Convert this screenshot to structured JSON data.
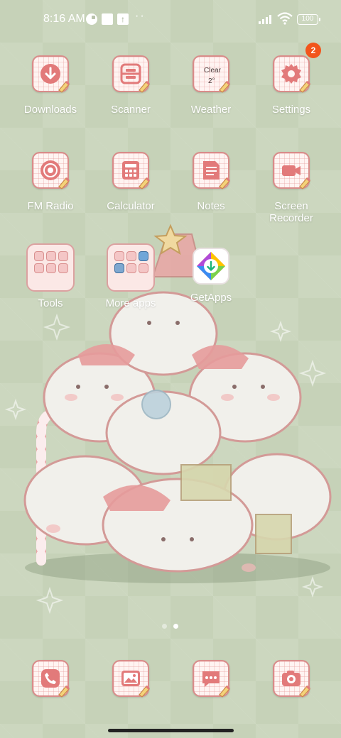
{
  "status_bar": {
    "time": "8:16 AM",
    "battery": "100",
    "icons": [
      "data-saver-icon",
      "notification-square-icon",
      "upload-icon",
      "more-dots-icon",
      "signal-icon",
      "wifi-icon",
      "battery-icon"
    ]
  },
  "apps": [
    {
      "label": "Downloads",
      "icon": "download-arrow-icon"
    },
    {
      "label": "Scanner",
      "icon": "scanner-icon"
    },
    {
      "label": "Weather",
      "icon": "weather-icon",
      "condition": "Clear",
      "temperature": "2°"
    },
    {
      "label": "Settings",
      "icon": "gear-icon",
      "badge": "2"
    },
    {
      "label": "FM Radio",
      "icon": "radio-icon"
    },
    {
      "label": "Calculator",
      "icon": "calculator-icon"
    },
    {
      "label": "Notes",
      "icon": "notes-icon"
    },
    {
      "label": "Screen\nRecorder",
      "icon": "video-camera-icon"
    },
    {
      "label": "Tools",
      "icon": "folder-icon"
    },
    {
      "label": "More apps",
      "icon": "folder-icon"
    },
    {
      "label": "GetApps",
      "icon": "getapps-icon"
    }
  ],
  "dock": [
    {
      "icon": "phone-icon"
    },
    {
      "icon": "gallery-icon"
    },
    {
      "icon": "messages-icon"
    },
    {
      "icon": "camera-icon"
    }
  ],
  "pages": {
    "count": 2,
    "active": 2
  },
  "colors": {
    "wallpaper": "#c6d2b8",
    "icon_outline": "#d98c8a",
    "icon_fill": "#fff4f2",
    "accent_pink": "#e27a7a",
    "badge": "#f2551c",
    "label": "#ffffff"
  }
}
